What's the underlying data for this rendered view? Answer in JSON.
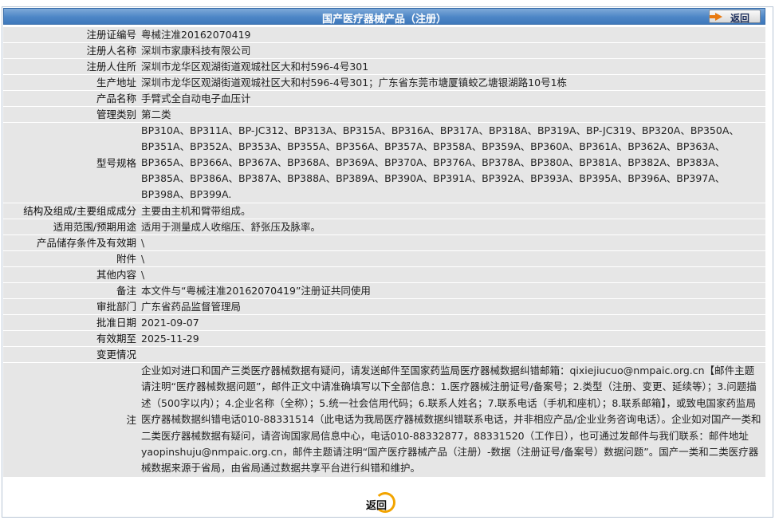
{
  "header": {
    "title": "国产医疗器械产品（注册）",
    "back_label": "返回"
  },
  "rows": [
    {
      "label": "注册证编号",
      "value": "粤械注准20162070419"
    },
    {
      "label": "注册人名称",
      "value": "深圳市家康科技有限公司"
    },
    {
      "label": "注册人住所",
      "value": "深圳市龙华区观湖街道观城社区大和村596-4号301"
    },
    {
      "label": "生产地址",
      "value": "深圳市龙华区观湖街道观城社区大和村596-4号301；广东省东莞市塘厦镇蛟乙塘银湖路10号1栋"
    },
    {
      "label": "产品名称",
      "value": "手臂式全自动电子血压计"
    },
    {
      "label": "管理类别",
      "value": "第二类"
    },
    {
      "label": "型号规格",
      "value": "BP310A、BP311A、BP-JC312、BP313A、BP315A、BP316A、BP317A、BP318A、BP319A、BP-JC319、BP320A、BP350A、BP351A、BP352A、BP353A、BP355A、BP356A、BP357A、BP358A、BP359A、BP360A、BP361A、BP362A、BP363A、BP365A、BP366A、BP367A、BP368A、BP369A、BP370A、BP376A、BP378A、BP380A、BP381A、BP382A、BP383A、BP385A、BP386A、BP387A、BP388A、BP389A、BP390A、BP391A、BP392A、BP393A、BP395A、BP396A、BP397A、BP398A、BP399A."
    },
    {
      "label": "结构及组成/主要组成成分",
      "value": "主要由主机和臂带组成。"
    },
    {
      "label": "适用范围/预期用途",
      "value": "适用于测量成人收缩压、舒张压及脉率。"
    },
    {
      "label": "产品储存条件及有效期",
      "value": "\\"
    },
    {
      "label": "附件",
      "value": "\\"
    },
    {
      "label": "其他内容",
      "value": "\\"
    },
    {
      "label": "备注",
      "value": "本文件与“粤械注准20162070419”注册证共同使用"
    },
    {
      "label": "审批部门",
      "value": "广东省药品监督管理局"
    },
    {
      "label": "批准日期",
      "value": "2021-09-07"
    },
    {
      "label": "有效期至",
      "value": "2025-11-29"
    },
    {
      "label": "变更情况",
      "value": ""
    },
    {
      "label": "注",
      "value": "企业如对进口和国产三类医疗器械数据有疑问，请发送邮件至国家药监局医疗器械数据纠错邮箱：qixiejiucuo@nmpaic.org.cn【邮件主题请注明“医疗器械数据问题”，邮件正文中请准确填写以下全部信息：1.医疗器械注册证号/备案号；2.类型（注册、变更、延续等）；3.问题描述（500字以内）；4.企业名称（全称）；5.统一社会信用代码；6.联系人姓名；7.联系电话（手机和座机）；8.联系邮箱】，或致电国家药监局医疗器械数据纠错电话010-88331514（此电话为我局医疗器械数据纠错联系电话，并非相应产品/企业业务咨询电话）。企业如对国产一类和二类医疗器械数据有疑问，请咨询国家局信息中心，电话010-88332877，88331520（工作日），也可通过发邮件与我们联系：邮件地址yaopinshuju@nmpaic.org.cn，邮件主题请注明“国产医疗器械产品（注册）-数据（注册证号/备案号）数据问题”。国产一类和二类医疗器械数据来源于省局，由省局通过数据共享平台进行纠错和维护。"
    }
  ],
  "footer": {
    "back_label": "返回"
  }
}
